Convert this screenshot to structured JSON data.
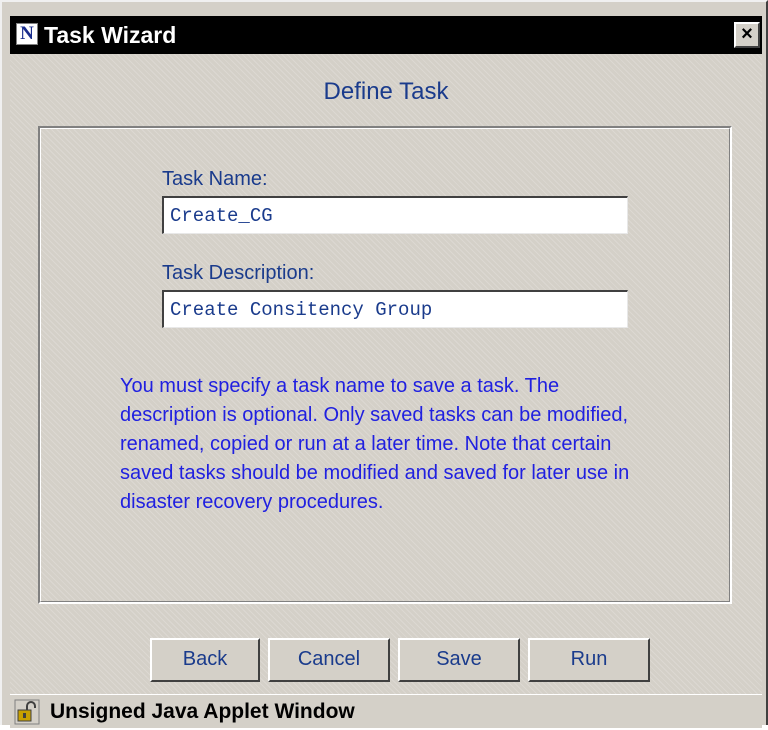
{
  "window": {
    "title": "Task Wizard",
    "icon_letter": "N",
    "close_label": "×"
  },
  "wizard": {
    "heading": "Define Task",
    "task_name": {
      "label": "Task Name:",
      "value": "Create_CG"
    },
    "task_description": {
      "label": "Task Description:",
      "value": "Create Consitency Group"
    },
    "info_text": "You must specify a task name to save a task. The description is optional. Only saved tasks can be modified, renamed, copied or run at a later time. Note that certain saved tasks should be modified and saved for later use in disaster recovery procedures."
  },
  "buttons": {
    "back": "Back",
    "cancel": "Cancel",
    "save": "Save",
    "run": "Run"
  },
  "status_bar": {
    "text": "Unsigned Java Applet Window",
    "icon": "unlocked-padlock-icon"
  },
  "colors": {
    "window_bg": "#d4d0c8",
    "title_bar": "#000000",
    "label_text": "#1a3b8c",
    "info_text": "#2020e0"
  }
}
